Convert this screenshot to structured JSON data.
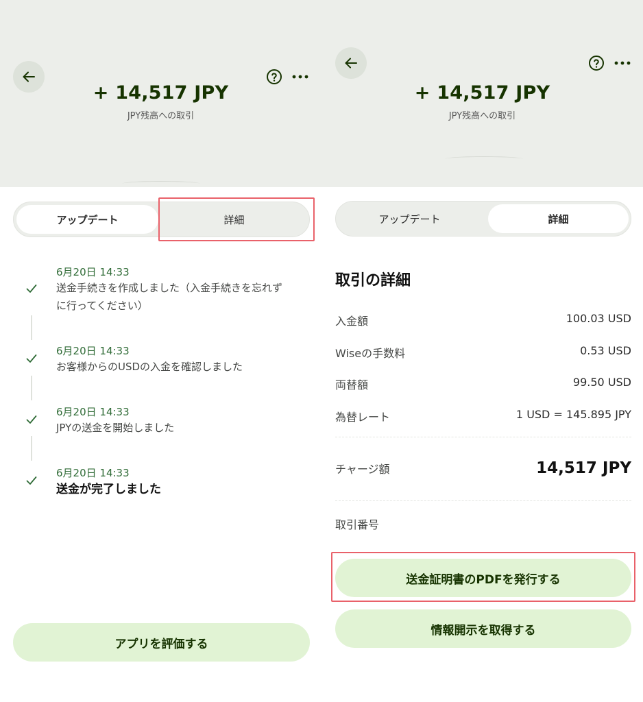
{
  "left": {
    "header": {
      "amount": "+ 14,517 JPY",
      "subtitle": "JPY残高への取引"
    },
    "tabs": [
      {
        "label": "アップデート",
        "active": true
      },
      {
        "label": "詳細",
        "active": false
      }
    ],
    "timeline": [
      {
        "date": "6月20日 14:33",
        "text_line1": "送金手続きを作成しました（入金手続きを忘れず",
        "text_line2": "に行ってください）"
      },
      {
        "date": "6月20日 14:33",
        "text_line1": "お客様からのUSDの入金を確認しました"
      },
      {
        "date": "6月20日 14:33",
        "text_line1": "JPYの送金を開始しました"
      },
      {
        "date": "6月20日 14:33",
        "text_line1": "送金が完了しました"
      }
    ],
    "rate_button": "アプリを評価する"
  },
  "right": {
    "header": {
      "amount": "+ 14,517 JPY",
      "subtitle": "JPY残高への取引"
    },
    "tabs": [
      {
        "label": "アップデート",
        "active": false
      },
      {
        "label": "詳細",
        "active": true
      }
    ],
    "details": {
      "title": "取引の詳細",
      "rows": [
        {
          "label": "入金額",
          "value": "100.03 USD"
        },
        {
          "label": "Wiseの手数料",
          "value": "0.53 USD"
        },
        {
          "label": "両替額",
          "value": "99.50 USD"
        },
        {
          "label": "為替レート",
          "value": "1 USD = 145.895 JPY"
        }
      ],
      "charge": {
        "label": "チャージ額",
        "value": "14,517 JPY"
      },
      "txn_label": "取引番号"
    },
    "pdf_button": "送金証明書のPDFを発行する",
    "disclosure_button": "情報開示を取得する"
  },
  "colors": {
    "brand_dark": "#163300",
    "accent_light": "#e1f3d4",
    "highlight": "#e9616a",
    "header_bg": "#eceeea"
  }
}
